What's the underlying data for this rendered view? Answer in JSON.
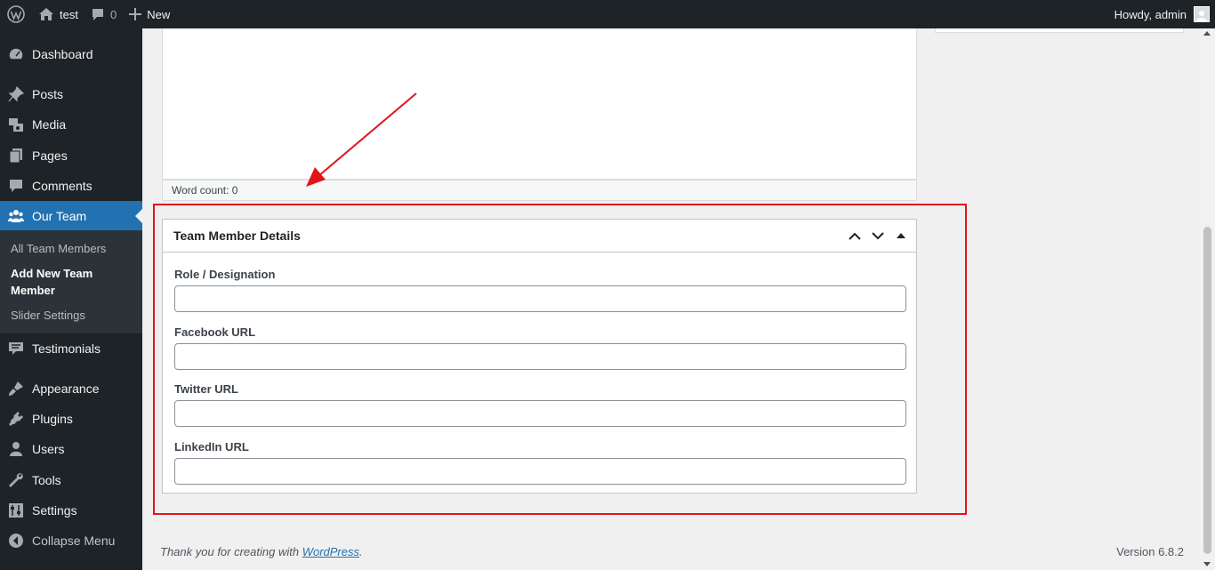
{
  "adminbar": {
    "site_name": "test",
    "comments_count": "0",
    "new_label": "New",
    "howdy": "Howdy, admin"
  },
  "sidebar": {
    "items": [
      {
        "label": "Dashboard",
        "icon": "dashboard-icon"
      },
      {
        "label": "Posts",
        "icon": "pin-icon"
      },
      {
        "label": "Media",
        "icon": "media-icon"
      },
      {
        "label": "Pages",
        "icon": "pages-icon"
      },
      {
        "label": "Comments",
        "icon": "comment-icon"
      },
      {
        "label": "Our Team",
        "icon": "groups-icon"
      },
      {
        "label": "Testimonials",
        "icon": "testimonial-icon"
      },
      {
        "label": "Appearance",
        "icon": "brush-icon"
      },
      {
        "label": "Plugins",
        "icon": "plug-icon"
      },
      {
        "label": "Users",
        "icon": "user-icon"
      },
      {
        "label": "Tools",
        "icon": "wrench-icon"
      },
      {
        "label": "Settings",
        "icon": "settings-icon"
      },
      {
        "label": "Collapse Menu",
        "icon": "collapse-icon"
      }
    ],
    "submenu": [
      {
        "label": "All Team Members"
      },
      {
        "label": "Add New Team Member"
      },
      {
        "label": "Slider Settings"
      }
    ]
  },
  "editor": {
    "word_count": "Word count: 0"
  },
  "metabox": {
    "title": "Team Member Details",
    "fields": [
      {
        "label": "Role / Designation",
        "value": ""
      },
      {
        "label": "Facebook URL",
        "value": ""
      },
      {
        "label": "Twitter URL",
        "value": ""
      },
      {
        "label": "LinkedIn URL",
        "value": ""
      }
    ]
  },
  "footer": {
    "thanks_prefix": "Thank you for creating with ",
    "thanks_link": "WordPress",
    "thanks_suffix": ".",
    "version": "Version 6.8.2"
  },
  "colors": {
    "adminbar_bg": "#1d2327",
    "accent": "#2271b1",
    "highlight": "#e0161b"
  }
}
